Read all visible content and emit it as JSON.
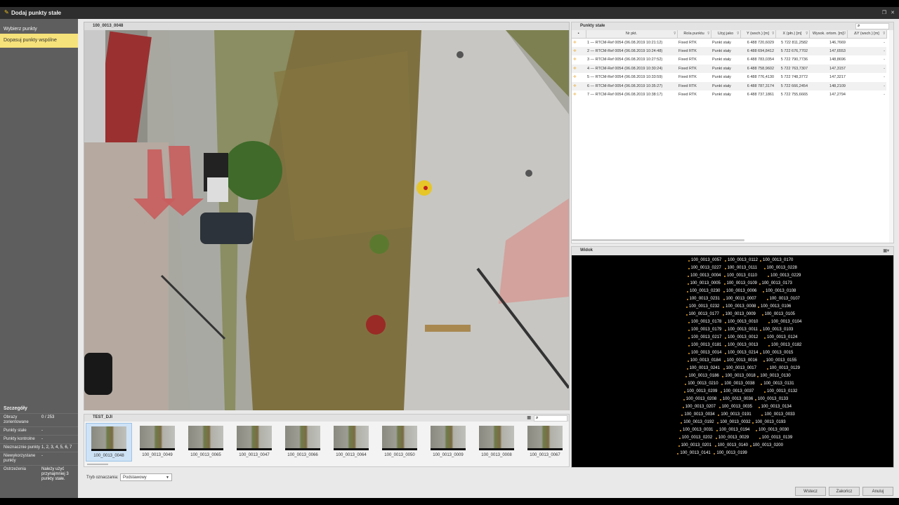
{
  "window": {
    "title": "Dodaj punkty stałe"
  },
  "sidebar": {
    "steps": [
      "Wybierz punkty",
      "Dopasuj punkty wspólne"
    ],
    "details_title": "Szczegóły",
    "details": [
      {
        "label": "Obrazy zorientowane",
        "value": "0 / 253"
      },
      {
        "label": "Punkty stałe",
        "value": "-"
      },
      {
        "label": "Punkty kontrolne",
        "value": "-"
      },
      {
        "label": "Nieznacznie punkty",
        "value": "1, 2, 3, 4, 5, 6, 7"
      },
      {
        "label": "Niewykorzystane punkty",
        "value": "-"
      },
      {
        "label": "Ostrzeżenia",
        "value": "Należy użyć przynajmniej 3 punkty stałe."
      }
    ]
  },
  "image_panel": {
    "title": "100_0013_0048"
  },
  "filmstrip": {
    "title": "TEST_DJI",
    "thumbs": [
      "100_0013_0048",
      "100_0013_0049",
      "100_0013_0065",
      "100_0013_0047",
      "100_0013_0066",
      "100_0013_0064",
      "100_0013_0050",
      "100_0013_0009",
      "100_0013_0008",
      "100_0013_0067"
    ]
  },
  "mode": {
    "label": "Tryb oznaczania:",
    "value": "Podstawowy"
  },
  "points_panel": {
    "title": "Punkty stałe",
    "columns": [
      "Nr pkt.",
      "Rola punktu",
      "Użyj jako",
      "Y (wsch.) [m]",
      "X (płn.) [m]",
      "Wysok. ortom. [m]",
      "ΔY (wsch.) [m]"
    ],
    "rows": [
      [
        "1 — RTCM-Ref 0054 (06.08.2019 10:21:12)",
        "Fixed RTK",
        "Punkt stały",
        "6 488 720,6029",
        "5 722 811,2582",
        "146,7669",
        "-"
      ],
      [
        "2 — RTCM-Ref 0054 (06.08.2019 10:24:48)",
        "Fixed RTK",
        "Punkt stały",
        "6 488 694,8412",
        "5 722 676,7702",
        "147,6553",
        "-"
      ],
      [
        "3 — RTCM-Ref 0054 (06.08.2019 10:27:52)",
        "Fixed RTK",
        "Punkt stały",
        "6 488 783,0354",
        "5 722 790,7736",
        "148,8696",
        "-"
      ],
      [
        "4 — RTCM-Ref 0054 (06.08.2019 10:30:24)",
        "Fixed RTK",
        "Punkt stały",
        "6 488 758,9602",
        "5 722 763,7307",
        "147,3157",
        "-"
      ],
      [
        "5 — RTCM-Ref 0054 (06.08.2019 10:33:59)",
        "Fixed RTK",
        "Punkt stały",
        "6 488 776,4130",
        "5 722 748,3772",
        "147,3217",
        "-"
      ],
      [
        "6 — RTCM-Ref 0054 (06.08.2019 10:35:27)",
        "Fixed RTK",
        "Punkt stały",
        "6 488 787,3174",
        "5 722 666,2454",
        "148,2109",
        "-"
      ],
      [
        "7 — RTCM-Ref 0054 (06.08.2019 10:38:17)",
        "Fixed RTK",
        "Punkt stały",
        "6 488 737,1861",
        "5 722 755,6665",
        "147,2794",
        "-"
      ]
    ]
  },
  "view_panel": {
    "title": "Widok",
    "labels": [
      "100_0013_0057",
      "100_0013_0112",
      "100_0013_0170",
      "100_0013_0227",
      "100_0013_0111",
      "100_0013_0228",
      "100_0013_0004",
      "100_0013_0110",
      "100_0013_0229",
      "100_0013_0005",
      "100_0013_0109",
      "100_0013_0173",
      "100_0013_0230",
      "100_0013_0006",
      "100_0013_0108",
      "100_0013_0231",
      "100_0013_0007",
      "100_0013_0107",
      "100_0013_0232",
      "100_0013_0008",
      "100_0013_0106",
      "100_0013_0177",
      "100_0013_0009",
      "100_0013_0105",
      "100_0013_0178",
      "100_0013_0010",
      "100_0013_0104",
      "100_0013_0179",
      "100_0013_0011",
      "100_0013_0103",
      "100_0013_0217",
      "100_0013_0012",
      "100_0013_0124",
      "100_0013_0181",
      "100_0013_0013",
      "100_0013_0182",
      "100_0013_0014",
      "100_0013_0214",
      "100_0013_0015",
      "100_0013_0184",
      "100_0013_0016",
      "100_0013_0155",
      "100_0013_0241",
      "100_0013_0017",
      "100_0013_0129",
      "100_0013_0186",
      "100_0013_0018",
      "100_0013_0130",
      "100_0013_0210",
      "100_0013_0038",
      "100_0013_0131",
      "100_0013_0209",
      "100_0013_0037",
      "100_0013_0132",
      "100_0013_0208",
      "100_0013_0036",
      "100_0013_0133",
      "100_0013_0207",
      "100_0013_0035",
      "100_0013_0134",
      "100_0013_0034",
      "100_0013_0191",
      "100_0013_0033",
      "100_0013_0192",
      "100_0013_0032",
      "100_0013_0193",
      "100_0013_0031",
      "100_0013_0194",
      "100_0013_0030",
      "100_0013_0202",
      "100_0013_0029",
      "100_0013_0139",
      "100_0013_0201",
      "100_0013_0140",
      "100_0013_0200",
      "100_0013_0141",
      "100_0013_0199"
    ]
  },
  "buttons": {
    "back": "Wstecz",
    "finish": "Zakończ",
    "cancel": "Anuluj"
  }
}
